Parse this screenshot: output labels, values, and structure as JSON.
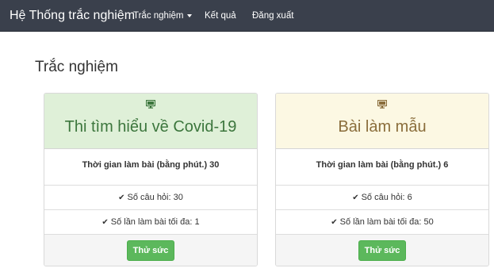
{
  "navbar": {
    "brand": "Hệ Thống trắc nghiệm",
    "items": [
      "Trắc nghiệm",
      "Kết quả",
      "Đăng xuất"
    ]
  },
  "page": {
    "title": "Trắc nghiệm"
  },
  "cards": [
    {
      "title": "Thi tìm hiểu về Covid-19",
      "duration": "Thời gian làm bài (bằng phút.) 30",
      "questions": "Số câu hỏi: 30",
      "attempts": "Số lần làm bài tối đa: 1",
      "button": "Thử sức",
      "icon": "monitor-icon",
      "accent": "#dff0d8"
    },
    {
      "title": "Bài làm mẫu",
      "duration": "Thời gian làm bài (bằng phút.) 6",
      "questions": "Số câu hỏi: 6",
      "attempts": "Số lần làm bài tối đa: 50",
      "button": "Thử sức",
      "icon": "monitor-icon",
      "accent": "#fcf8e3"
    }
  ],
  "colors": {
    "navbar": "#3a404c",
    "button": "#5cb85c"
  }
}
